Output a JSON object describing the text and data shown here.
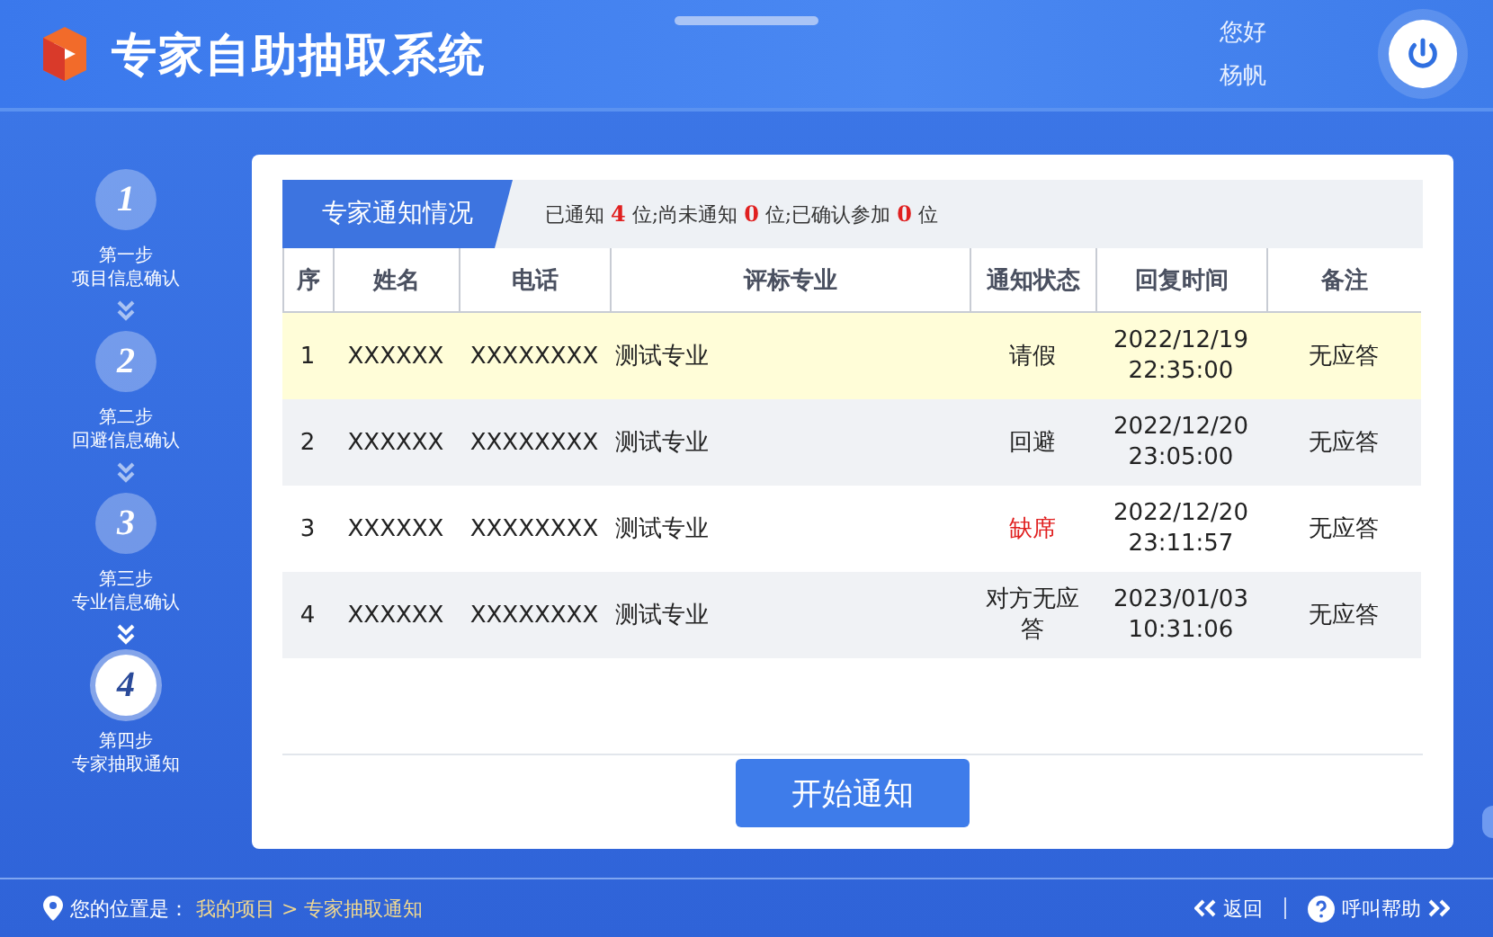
{
  "header": {
    "title": "专家自助抽取系统",
    "greeting": "您好",
    "user": "杨帆"
  },
  "steps": [
    {
      "number": "1",
      "label": "第一步",
      "name": "项目信息确认",
      "selected": false
    },
    {
      "number": "2",
      "label": "第二步",
      "name": "回避信息确认",
      "selected": false
    },
    {
      "number": "3",
      "label": "第三步",
      "name": "专业信息确认",
      "selected": false
    },
    {
      "number": "4",
      "label": "第四步",
      "name": "专家抽取通知",
      "selected": true
    }
  ],
  "panel": {
    "title": "专家通知情况",
    "summary": "已通知 **4** 位;尚未通知 **0** 位;已确认参加 **0** 位"
  },
  "table": {
    "columns": [
      "序",
      "姓名",
      "电话",
      "评标专业",
      "通知状态",
      "回复时间",
      "备注"
    ],
    "rows": [
      {
        "cells": [
          "1",
          "XXXXXX",
          "XXXXXXXX",
          "测试专业",
          "请假",
          "2022/12/19 22:35:00",
          "无应答"
        ],
        "selected": true,
        "color": "#222222"
      },
      {
        "cells": [
          "2",
          "XXXXXX",
          "XXXXXXXX",
          "测试专业",
          "回避",
          "2022/12/20 23:05:00",
          "无应答"
        ],
        "selected": false,
        "color": "#222222"
      },
      {
        "cells": [
          "3",
          "XXXXXX",
          "XXXXXXXX",
          "测试专业",
          "缺席",
          "2022/12/20 23:11:57",
          "无应答"
        ],
        "selected": false,
        "color": "#e02020"
      },
      {
        "cells": [
          "4",
          "XXXXXX",
          "XXXXXXXX",
          "测试专业",
          "对方无应答",
          "2023/01/03 10:31:06",
          "无应答"
        ],
        "selected": false,
        "color": "#222222"
      }
    ]
  },
  "action_button": "开始通知",
  "footer": {
    "location_label": "您的位置是：",
    "breadcrumb": "我的项目 > 专家抽取通知",
    "back": "返回",
    "help": "呼叫帮助"
  }
}
